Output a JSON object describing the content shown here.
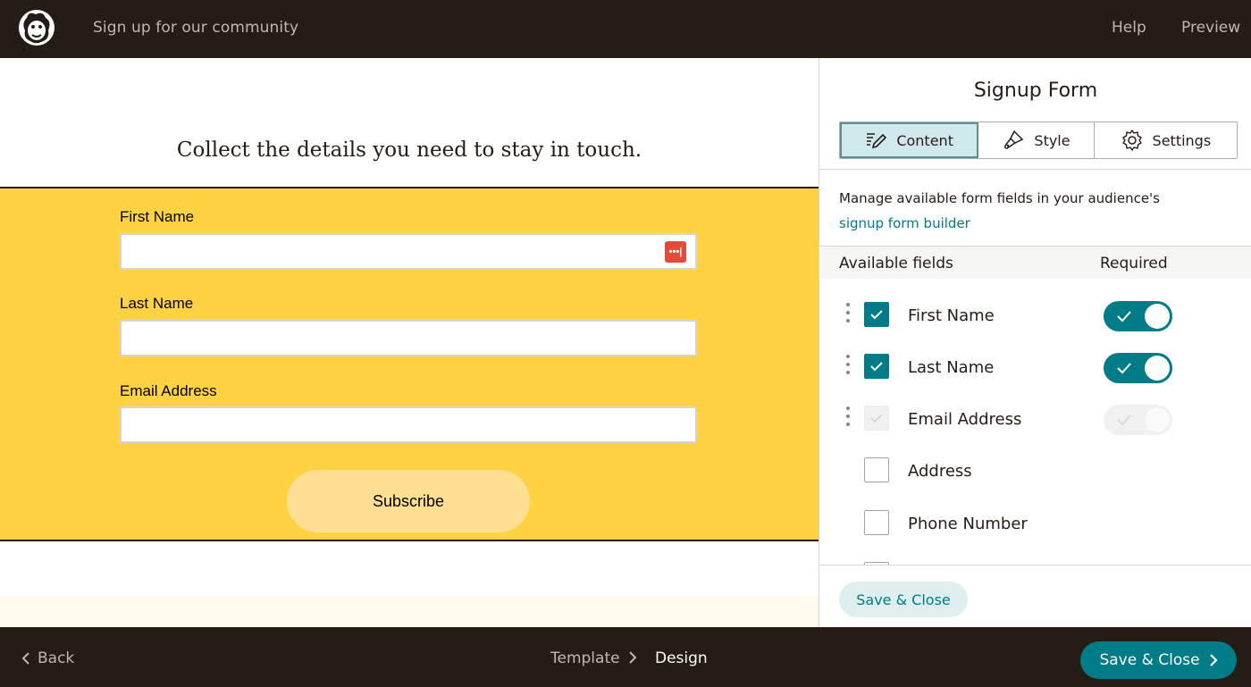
{
  "topbar": {
    "title": "Sign up for our community",
    "help": "Help",
    "preview": "Preview"
  },
  "canvas": {
    "heading": "Collect the details you need to stay in touch.",
    "fields": [
      {
        "label": "First Name",
        "value": ""
      },
      {
        "label": "Last Name",
        "value": ""
      },
      {
        "label": "Email Address",
        "value": ""
      }
    ],
    "subscribe_label": "Subscribe",
    "password_icon_text": "•••|"
  },
  "panel": {
    "title": "Signup Form",
    "tabs": [
      {
        "label": "Content",
        "icon": "pencil-lines-icon",
        "active": true
      },
      {
        "label": "Style",
        "icon": "paint-brush-icon",
        "active": false
      },
      {
        "label": "Settings",
        "icon": "gear-icon",
        "active": false
      }
    ],
    "manage_text": "Manage available form fields in your audience's",
    "manage_link": "signup form builder",
    "columns": {
      "available": "Available fields",
      "required": "Required"
    },
    "fields": [
      {
        "name": "First Name",
        "checked": true,
        "required": true
      },
      {
        "name": "Last Name",
        "checked": true,
        "required": true
      },
      {
        "name": "Email Address",
        "checked": true,
        "required": true
      },
      {
        "name": "Address",
        "checked": false
      },
      {
        "name": "Phone Number",
        "checked": false
      }
    ],
    "save_label": "Save & Close"
  },
  "bottombar": {
    "back": "Back",
    "breadcrumb": [
      "Template",
      "Design"
    ],
    "save_label": "Save & Close"
  },
  "colors": {
    "accent": "#007c89",
    "form_band": "#ffd244",
    "dark": "#241c15"
  }
}
